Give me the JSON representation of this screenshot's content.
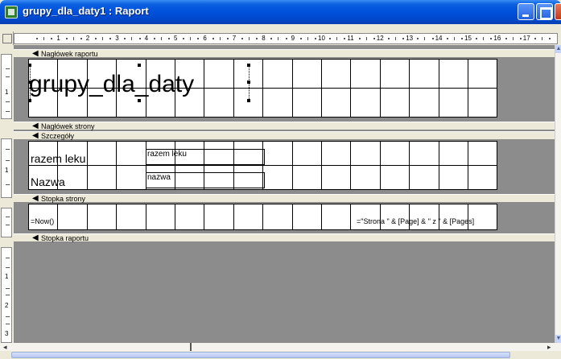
{
  "window": {
    "title": "grupy_dla_daty1 : Raport",
    "icon": "access-report-icon"
  },
  "ruler": {
    "numbers": [
      "1",
      "2",
      "3",
      "4",
      "5",
      "6",
      "7",
      "8",
      "9",
      "10",
      "11",
      "12",
      "13",
      "14",
      "15",
      "16",
      "17"
    ]
  },
  "vertical_ruler": {
    "report_header_numbers": [
      "1"
    ],
    "detail_numbers": [
      "1"
    ],
    "report_footer_numbers": [
      "1",
      "2",
      "3"
    ]
  },
  "sections": {
    "report_header": "Nagłówek raportu",
    "page_header": "Nagłówek strony",
    "detail": "Szczegóły",
    "page_footer": "Stopka strony",
    "report_footer": "Stopka raportu"
  },
  "controls": {
    "report_title": "grupy_dla_daty",
    "label_razem_leku": "razem leku",
    "field_razem_leku": "razem leku",
    "label_nazwa": "Nazwa",
    "field_nazwa": "nazwa",
    "footer_now": "=Now()",
    "footer_page": "=\"Strona \" & [Page] & \" z \" & [Pages]"
  },
  "colors": {
    "titlebar": "#0050DC",
    "canvas_bg": "#8C8C8C",
    "window_bg": "#ECE9D8"
  }
}
